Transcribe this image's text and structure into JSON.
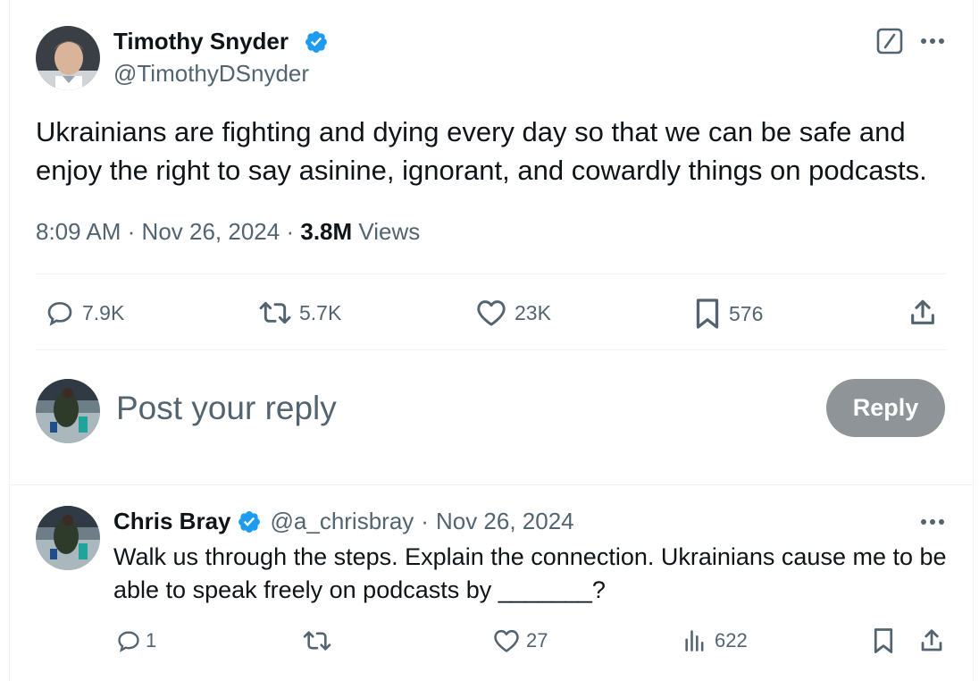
{
  "main_tweet": {
    "author_name": "Timothy Snyder",
    "author_handle": "@TimothyDSnyder",
    "verified": true,
    "text": "Ukrainians are fighting and dying every day so that we can be safe and enjoy the right to say asinine, ignorant, and cowardly things on podcasts.",
    "time": "8:09 AM",
    "separator": "·",
    "date": "Nov 26, 2024",
    "views_count": "3.8M",
    "views_label": "Views",
    "actions": {
      "replies": "7.9K",
      "retweets": "5.7K",
      "likes": "23K",
      "bookmarks": "576"
    }
  },
  "reply_box": {
    "placeholder": "Post your reply",
    "button_label": "Reply"
  },
  "reply_tweet": {
    "author_name": "Chris Bray",
    "author_handle": "@a_chrisbray",
    "verified": true,
    "separator": "·",
    "date": "Nov 26, 2024",
    "text": "Walk us through the steps. Explain the connection. Ukrainians cause me to be able to speak freely on podcasts by _______?",
    "actions": {
      "replies": "1",
      "retweets": "",
      "likes": "27",
      "views": "622"
    }
  },
  "colors": {
    "accent_blue": "#1d9bf0",
    "text_primary": "#0f1419",
    "text_secondary": "#536471",
    "button_disabled": "#8f9498",
    "divider": "#eff3f4"
  }
}
